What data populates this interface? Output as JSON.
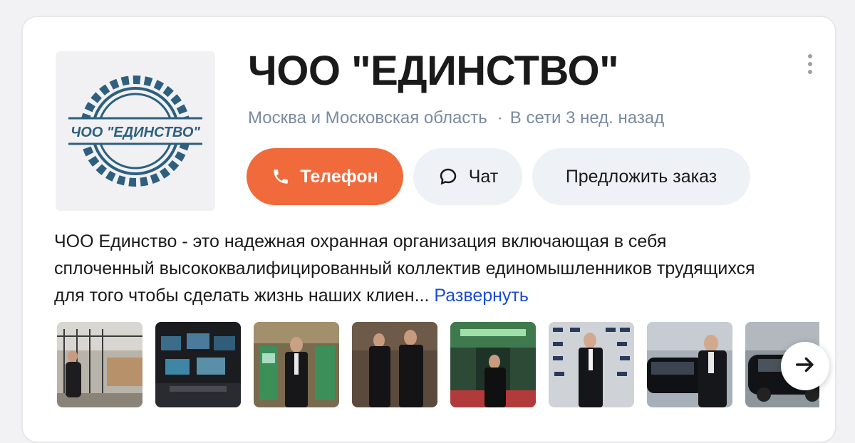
{
  "company": {
    "name": "ЧОО \"ЕДИНСТВО\"",
    "logo_text": "ЧОО \"ЕДИНСТВО\"",
    "region": "Москва и Московская область",
    "separator": "·",
    "status": "В сети 3 нед. назад"
  },
  "actions": {
    "phone_label": "Телефон",
    "chat_label": "Чат",
    "order_label": "Предложить заказ"
  },
  "description": {
    "text": "ЧОО Единство - это надежная охранная организация включающая в себя сплоченный высококвалифицированный коллектив единомышленников трудящихся для того чтобы сделать жизнь наших клиен...",
    "expand_label": "Развернуть"
  },
  "gallery": {
    "photos": [
      "guard-at-fence",
      "control-room-monitors",
      "guard-at-atm",
      "two-guards-indoors",
      "guard-at-event-entrance",
      "guard-at-press-wall",
      "guard-by-car",
      "black-car"
    ]
  },
  "icons": {
    "phone": "phone-icon",
    "chat": "chat-bubble-icon",
    "more": "more-vertical-icon",
    "next": "arrow-right-icon"
  },
  "colors": {
    "accent": "#f06a3b",
    "link": "#1a4bd8",
    "logo_blue": "#2e5f7e",
    "muted": "#7a8aa0"
  }
}
